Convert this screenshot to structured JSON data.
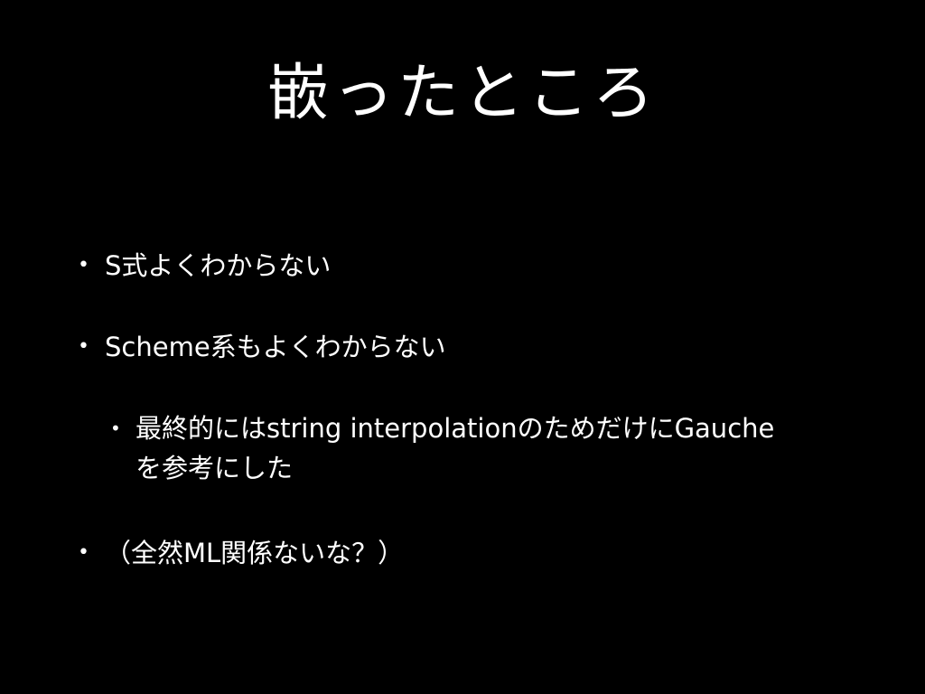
{
  "slide": {
    "title": "嵌ったところ",
    "bullets": [
      {
        "text": "S式よくわからない"
      },
      {
        "text": "Scheme系もよくわからない"
      },
      {
        "line1": "最終的にはstring interpolationのためだけにGauche",
        "line2": "を参考にした"
      },
      {
        "text": "（全然ML関係ないな？）"
      }
    ],
    "bullet_glyph": "•",
    "colors": {
      "background": "#000000",
      "text": "#ffffff"
    }
  }
}
